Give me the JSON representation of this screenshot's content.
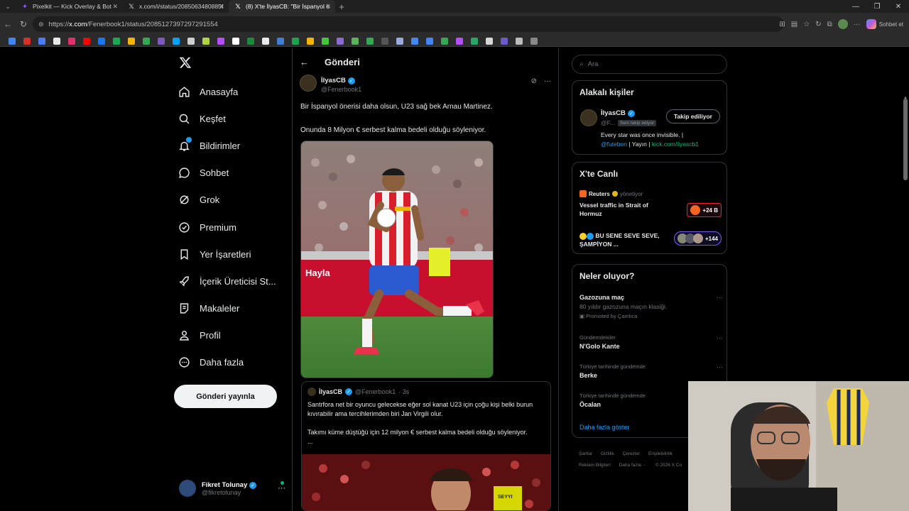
{
  "browser": {
    "tabs": [
      {
        "title": "Pixelkit — Kick Overlay & Bot",
        "favicon": "pixelkit-icon"
      },
      {
        "title": "x.com/i/status/20850634808858",
        "favicon": "x-icon"
      },
      {
        "title": "(8) X'te İlyasCB: \"Bir İspanyol öneri",
        "favicon": "x-icon"
      }
    ],
    "url_prefix": "https://",
    "url_host": "x.com",
    "url_path": "/Fenerbook1/status/2085127397297291554",
    "profile_button": "Sohbet et"
  },
  "nav": {
    "items": [
      {
        "label": "Anasayfa",
        "icon": "home-icon"
      },
      {
        "label": "Keşfet",
        "icon": "search-icon"
      },
      {
        "label": "Bildirimler",
        "icon": "bell-icon"
      },
      {
        "label": "Sohbet",
        "icon": "chat-icon"
      },
      {
        "label": "Grok",
        "icon": "grok-icon"
      },
      {
        "label": "Premium",
        "icon": "premium-icon"
      },
      {
        "label": "Yer İşaretleri",
        "icon": "bookmark-icon"
      },
      {
        "label": "İçerik Üreticisi St...",
        "icon": "rocket-icon"
      },
      {
        "label": "Makaleler",
        "icon": "article-icon"
      },
      {
        "label": "Profil",
        "icon": "person-icon"
      },
      {
        "label": "Daha fazla",
        "icon": "more-circle-icon"
      }
    ],
    "post_button": "Gönderi yayınla",
    "me": {
      "name": "Fikret Tolunay",
      "handle": "@fikretolunay"
    }
  },
  "main": {
    "header_title": "Gönderi",
    "tweet": {
      "author": "İlyasCB",
      "handle": "@Fenerbook1",
      "text_1": "Bir İspanyol önerisi daha olsun, U23 sağ bek Arnau Martinez.",
      "text_2": "Onunda 8 Milyon € serbest kalma bedeli olduğu söyleniyor."
    },
    "quote": {
      "author": "İlyasCB",
      "handle": "@Fenerbook1",
      "time": "· 3s",
      "text_1": "Santrfora net bir oyuncu gelecekse eğer sol kanat U23 için çoğu kişi belki burun kıvırabilir ama tercihlerimden biri Jan Virgili olur.",
      "text_2": "Takımı küme düştüğü için 12 milyon € serbest kalma bedeli olduğu söyleniyor.",
      "ellipsis": "..."
    }
  },
  "sidebar": {
    "search_placeholder": "Ara",
    "related": {
      "title": "Alakalı kişiler",
      "name": "İlyasCB",
      "handle": "@F...",
      "follows_you": "Seni takip ediyor",
      "button": "Takip ediliyor",
      "bio_1": "Every star was once invisible. |",
      "bio_link_1": "@futebon",
      "bio_sep": " | Yayın | ",
      "bio_link_2": "kick.com/ilyascb1"
    },
    "live": {
      "title": "X'te Canlı",
      "items": [
        {
          "source": "Reuters",
          "status": "yönetiyor",
          "title": "Vessel traffic in Strait of Hormuz",
          "count": "+24 B"
        },
        {
          "source": "",
          "status": "",
          "title": "BU SENE SEVE SEVE, ŞAMPİYON ...",
          "count": "+144"
        }
      ]
    },
    "trends": {
      "title": "Neler oluyor?",
      "items": [
        {
          "context": "",
          "title": "Gazozuna maç",
          "desc": "80 yıldır gazozuna maçın klasiği.",
          "promo": "Promoted by Çamlıca"
        },
        {
          "context": "Gündemdekiler",
          "title": "N'Golo Kante",
          "desc": "",
          "promo": ""
        },
        {
          "context": "Türkiye tarihinde gündemde",
          "title": "Berke",
          "desc": "",
          "promo": ""
        },
        {
          "context": "Türkiye tarihinde gündemde",
          "title": "Öcalan",
          "desc": "",
          "promo": ""
        }
      ],
      "show_more": "Daha fazla göster"
    },
    "footer": {
      "row1": [
        "Şartlar",
        "Gizlilik",
        "Çerezler",
        "Erişilebilirlik"
      ],
      "row2": [
        "Reklam Bilgileri",
        "Daha fazla ···",
        "© 2026 X Co"
      ]
    }
  },
  "colors": {
    "accent": "#1d9bf0",
    "background": "#000000",
    "border": "#2f3336",
    "muted": "#71767b"
  }
}
